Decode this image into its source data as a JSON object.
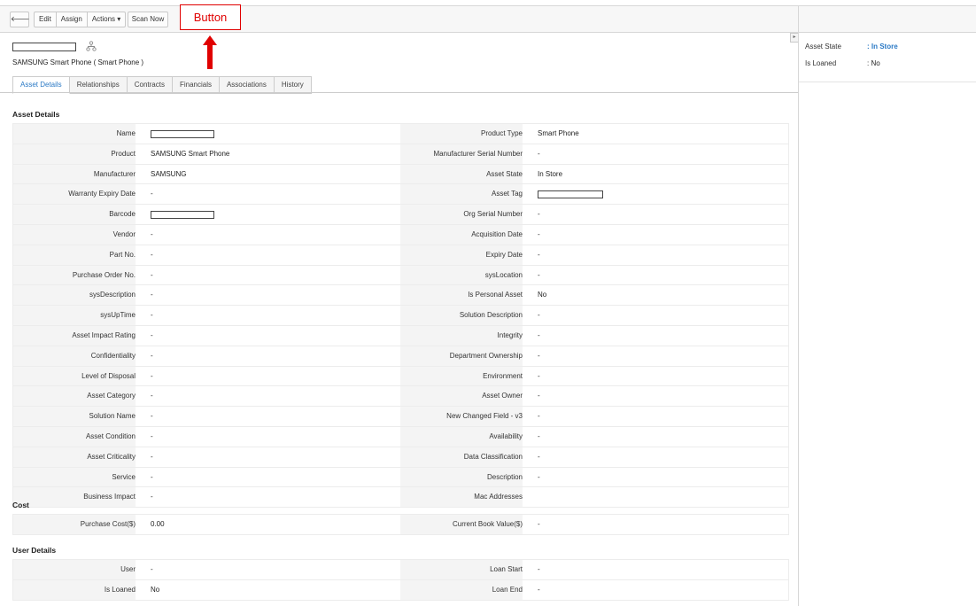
{
  "toolbar": {
    "back_label": "🡐",
    "edit_label": "Edit",
    "assign_label": "Assign",
    "actions_label": "Actions ▾",
    "scan_label": "Scan Now"
  },
  "annotation": {
    "label": "Button",
    "color": "#e00000"
  },
  "header": {
    "subtitle": "SAMSUNG Smart Phone ( Smart Phone )"
  },
  "tabs": [
    {
      "label": "Asset Details"
    },
    {
      "label": "Relationships"
    },
    {
      "label": "Contracts"
    },
    {
      "label": "Financials"
    },
    {
      "label": "Associations"
    },
    {
      "label": "History"
    }
  ],
  "sections": {
    "asset_details": "Asset Details",
    "cost": "Cost",
    "user_details": "User Details"
  },
  "asset_rows": [
    {
      "l": "Name",
      "lv": "",
      "r": "Product Type",
      "rv": "Smart Phone"
    },
    {
      "l": "Product",
      "lv": "SAMSUNG Smart Phone",
      "r": "Manufacturer Serial Number",
      "rv": "-"
    },
    {
      "l": "Manufacturer",
      "lv": "SAMSUNG",
      "r": "Asset State",
      "rv": "In Store"
    },
    {
      "l": "Warranty Expiry Date",
      "lv": "-",
      "r": "Asset Tag",
      "rv": ""
    },
    {
      "l": "Barcode",
      "lv": "",
      "r": "Org Serial Number",
      "rv": "-"
    },
    {
      "l": "Vendor",
      "lv": "-",
      "r": "Acquisition Date",
      "rv": "-"
    },
    {
      "l": "Part No.",
      "lv": "-",
      "r": "Expiry Date",
      "rv": "-"
    },
    {
      "l": "Purchase Order No.",
      "lv": "-",
      "r": "sysLocation",
      "rv": "-"
    },
    {
      "l": "sysDescription",
      "lv": "-",
      "r": "Is Personal Asset",
      "rv": "No"
    },
    {
      "l": "sysUpTime",
      "lv": "-",
      "r": "Solution Description",
      "rv": "-"
    },
    {
      "l": "Asset Impact Rating",
      "lv": "-",
      "r": "Integrity",
      "rv": "-"
    },
    {
      "l": "Confidentiality",
      "lv": "-",
      "r": "Department Ownership",
      "rv": "-"
    },
    {
      "l": "Level of Disposal",
      "lv": "-",
      "r": "Environment",
      "rv": "-"
    },
    {
      "l": "Asset Category",
      "lv": "-",
      "r": "Asset Owner",
      "rv": "-"
    },
    {
      "l": "Solution Name",
      "lv": "-",
      "r": "New Changed Field - v3",
      "rv": "-"
    },
    {
      "l": "Asset Condition",
      "lv": "-",
      "r": "Availability",
      "rv": "-"
    },
    {
      "l": "Asset Criticality",
      "lv": "-",
      "r": "Data Classification",
      "rv": "-"
    },
    {
      "l": "Service",
      "lv": "-",
      "r": "Description",
      "rv": "-"
    },
    {
      "l": "Business Impact",
      "lv": "-",
      "r": "Mac Addresses",
      "rv": ""
    }
  ],
  "cost_rows": [
    {
      "l": "Purchase Cost($)",
      "lv": "0.00",
      "r": "Current Book Value($)",
      "rv": "-"
    }
  ],
  "user_rows": [
    {
      "l": "User",
      "lv": "-",
      "r": "Loan Start",
      "rv": "-"
    },
    {
      "l": "Is Loaned",
      "lv": "No",
      "r": "Loan End",
      "rv": "-"
    }
  ],
  "right_panel": {
    "asset_state_label": "Asset State",
    "asset_state_value": ": In Store",
    "is_loaned_label": "Is Loaned",
    "is_loaned_value": ": No",
    "link_color": "#2a79c5"
  }
}
